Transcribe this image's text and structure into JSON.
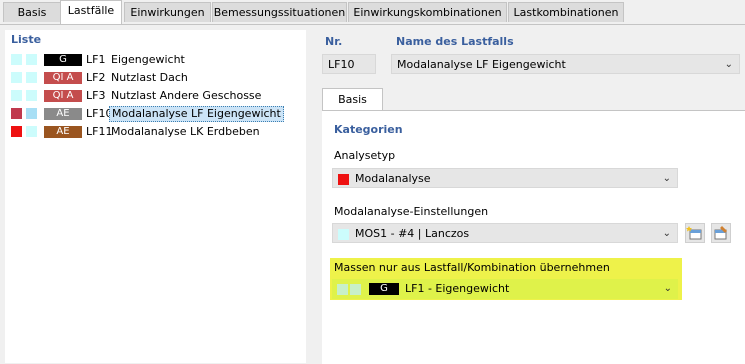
{
  "tabs": [
    {
      "label": "Basis",
      "active": false
    },
    {
      "label": "Lastfälle",
      "active": true
    },
    {
      "label": "Einwirkungen",
      "active": false
    },
    {
      "label": "Bemessungssituationen",
      "active": false
    },
    {
      "label": "Einwirkungskombinationen",
      "active": false
    },
    {
      "label": "Lastkombinationen",
      "active": false
    }
  ],
  "list": {
    "title": "Liste",
    "items": [
      {
        "color1": "#ccfcfc",
        "color2": "#ccfcfc",
        "badge": "G",
        "badge_color": "#000000",
        "id": "LF1",
        "name": "Eigengewicht",
        "selected": false
      },
      {
        "color1": "#ccfcfc",
        "color2": "#ccfcfc",
        "badge": "QI A",
        "badge_color": "#c44d4d",
        "id": "LF2",
        "name": "Nutzlast Dach",
        "selected": false
      },
      {
        "color1": "#ccfcfc",
        "color2": "#ccfcfc",
        "badge": "QI A",
        "badge_color": "#c44d4d",
        "id": "LF3",
        "name": "Nutzlast Andere Geschosse",
        "selected": false
      },
      {
        "color1": "#c0394d",
        "color2": "#a8dff5",
        "badge": "AE",
        "badge_color": "#8a8a8a",
        "id": "LF10",
        "name": "Modalanalyse LF Eigengewicht",
        "selected": true
      },
      {
        "color1": "#ee1111",
        "color2": "#ccfcfc",
        "badge": "AE",
        "badge_color": "#9a5520",
        "id": "LF11",
        "name": "Modalanalyse LK Erdbeben",
        "selected": false
      }
    ]
  },
  "header": {
    "nr_label": "Nr.",
    "nr_value": "LF10",
    "name_label": "Name des Lastfalls",
    "name_value": "Modalanalyse LF Eigengewicht"
  },
  "inner_tab": "Basis",
  "kategorien": {
    "title": "Kategorien",
    "analysetyp_label": "Analysetyp",
    "analysetyp_value": "Modalanalyse",
    "analysetyp_color": "#ee1111",
    "settings_label": "Modalanalyse-Einstellungen",
    "settings_value": "MOS1 - #4 | Lanczos",
    "settings_color": "#ccfcfc",
    "massen_label": "Massen nur aus Lastfall/Kombination  übernehmen",
    "massen_badge": "G",
    "massen_value": "LF1 - Eigengewicht",
    "massen_color": "#dff24a"
  }
}
